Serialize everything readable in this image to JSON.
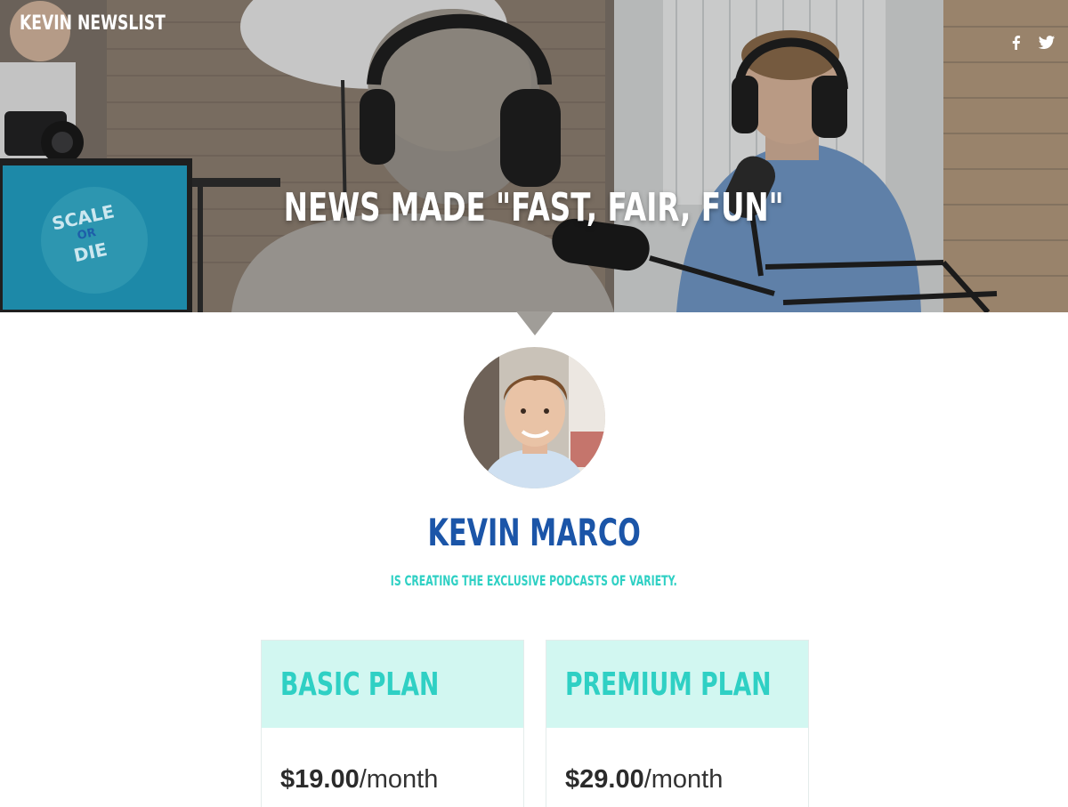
{
  "header": {
    "brand": "KEVIN NEWSLIST",
    "headline": "NEWS MADE \"FAST, FAIR, FUN\"",
    "monitor_text": [
      "SCALE",
      "OR",
      "DIE"
    ],
    "social": [
      {
        "icon": "facebook-icon",
        "label": "f"
      },
      {
        "icon": "twitter-icon",
        "label": "twitter"
      }
    ]
  },
  "profile": {
    "name": "KEVIN MARCO",
    "tagline": "IS CREATING THE EXCLUSIVE PODCASTS OF VARIETY."
  },
  "plans": [
    {
      "title": "BASIC PLAN",
      "price": "$19.00",
      "period": "/month"
    },
    {
      "title": "PREMIUM PLAN",
      "price": "$29.00",
      "period": "/month"
    }
  ],
  "colors": {
    "accent_teal": "#2fd0c4",
    "plan_header_bg": "#d2f7f1",
    "name_blue": "#1b55a8",
    "monitor_blue": "#1fa3c9"
  }
}
